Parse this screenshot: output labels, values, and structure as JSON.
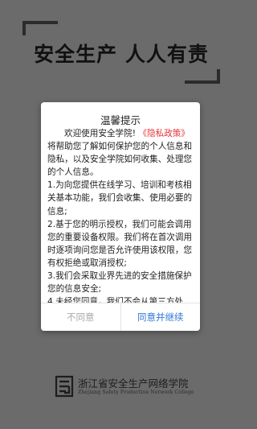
{
  "banner": {
    "title": "安全生产 人人有责"
  },
  "dialog": {
    "title": "温馨提示",
    "intro_prefix": "欢迎使用安全学院! ",
    "policy_link": "《隐私政策》",
    "intro_suffix": "将帮助您了解如何保护您的个人信息和隐私，以及安全学院如何收集、处理您的个人信息。",
    "items": [
      "1.为向您提供在线学习、培训和考核相关基本功能，我们会收集、使用必要的信息;",
      "2.基于您的明示授权，我们可能会调用您的重要设备权限。我们将在首次调用时逐项询问您是否允许使用该权限，您有权拒绝或取消授权;",
      "3.我们会采取业界先进的安全措施保护您的信息安全;",
      "4.未经您同意，我们不会从第三方处"
    ],
    "cancel_label": "不同意",
    "confirm_label": "同意并继续"
  },
  "footer": {
    "school_name_cn": "浙江省安全生产网络学院",
    "school_name_en": "Zhejiang Safety Production Network College"
  },
  "colors": {
    "background": "#6b6b6b",
    "link": "#e4353a",
    "confirm": "#2f78d6",
    "cancel": "#a8a8a8"
  }
}
